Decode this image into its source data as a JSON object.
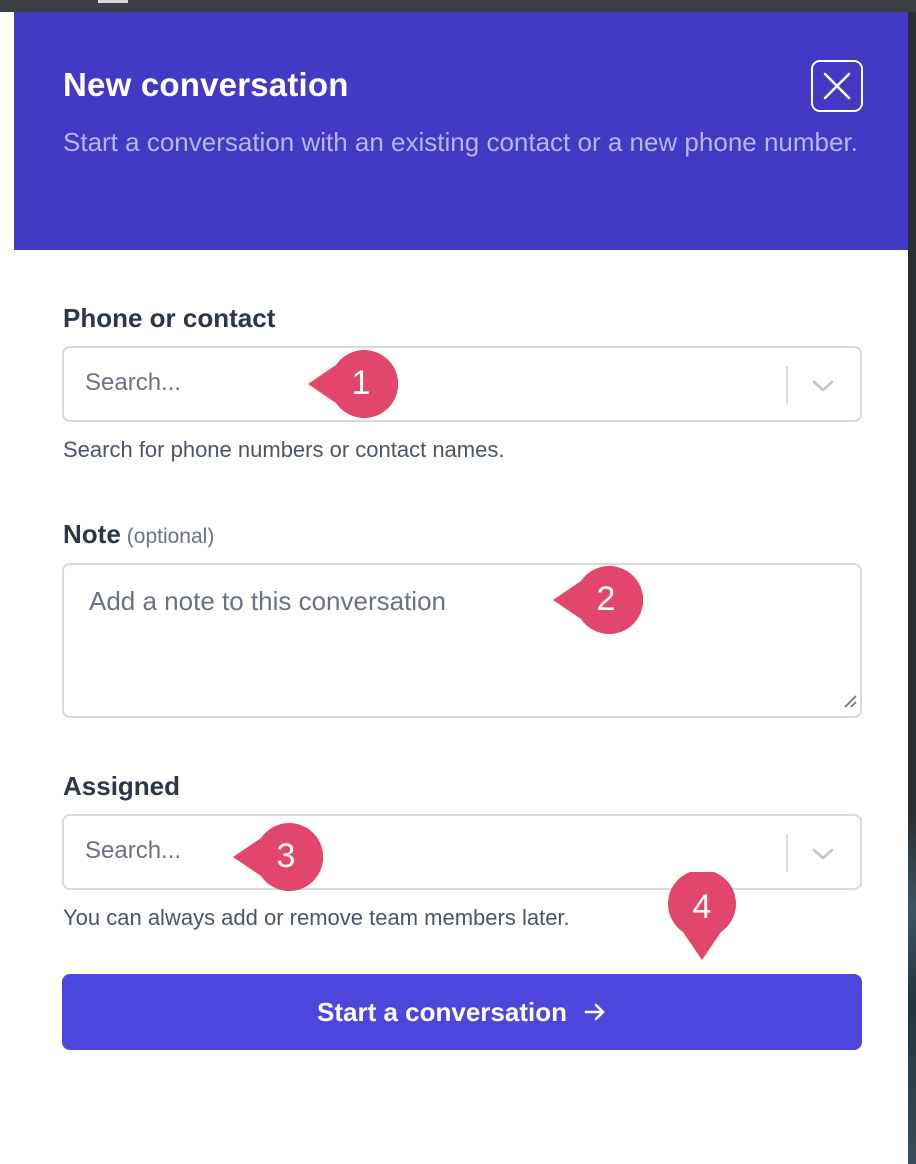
{
  "header": {
    "title": "New conversation",
    "subtitle": "Start a conversation with an existing contact or a new phone number.",
    "close_icon": "close-icon",
    "background": "#4239c4"
  },
  "phone_field": {
    "label": "Phone or contact",
    "placeholder": "Search...",
    "help": "Search for phone numbers or contact names."
  },
  "note_field": {
    "label": "Note",
    "optional": "(optional)",
    "placeholder": "Add a note to this conversation"
  },
  "assigned_field": {
    "label": "Assigned",
    "placeholder": "Search...",
    "help": "You can always add or remove team members later."
  },
  "submit": {
    "label": "Start a conversation",
    "icon": "arrow-right-icon",
    "color": "#4c46dc"
  },
  "callouts": {
    "color": "#e2476b",
    "items": [
      "1",
      "2",
      "3",
      "4"
    ]
  }
}
